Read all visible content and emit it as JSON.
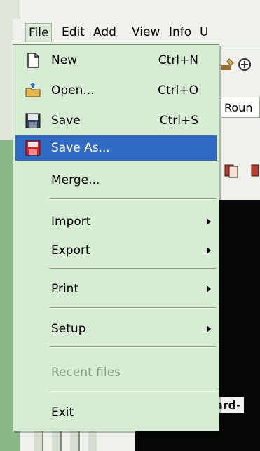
{
  "menubar": {
    "file": "File",
    "edit": "Edit",
    "add": "Add",
    "view": "View",
    "info": "Info",
    "u": "U"
  },
  "toolbar": {
    "round_field_value": "Roun"
  },
  "background": {
    "board_label": "oard-"
  },
  "file_menu": {
    "new": {
      "label": "New",
      "shortcut": "Ctrl+N"
    },
    "open": {
      "label": "Open...",
      "shortcut": "Ctrl+O"
    },
    "save": {
      "label": "Save",
      "shortcut": "Ctrl+S"
    },
    "save_as": {
      "label": "Save As..."
    },
    "merge": {
      "label": "Merge..."
    },
    "import": {
      "label": "Import"
    },
    "export": {
      "label": "Export"
    },
    "print": {
      "label": "Print"
    },
    "setup": {
      "label": "Setup"
    },
    "recent_files": {
      "label": "Recent files"
    },
    "exit": {
      "label": "Exit"
    }
  },
  "colors": {
    "menu_bg": "#d6ecd3",
    "highlight": "#316ac5",
    "disabled_text": "#86a183"
  }
}
